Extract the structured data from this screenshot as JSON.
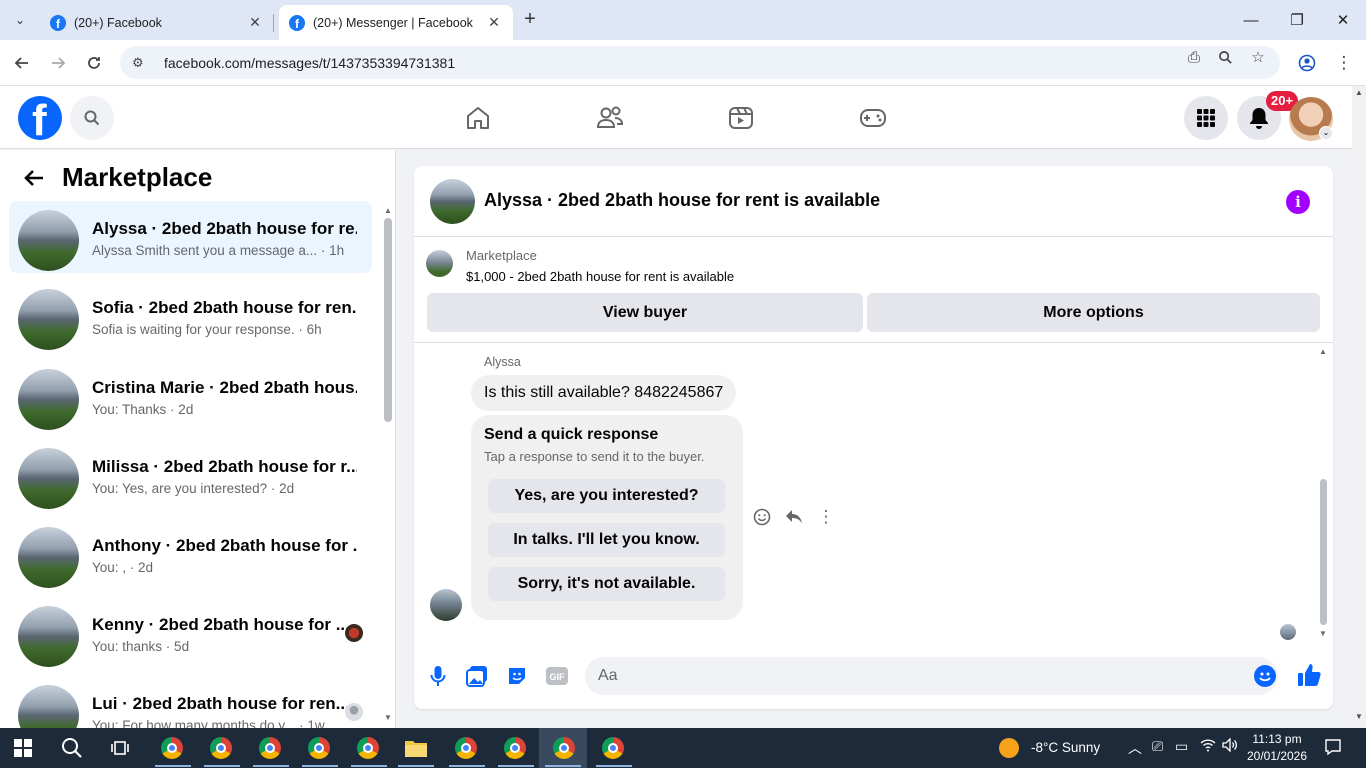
{
  "browser": {
    "tabs": [
      {
        "title": "(20+) Facebook",
        "active": false
      },
      {
        "title": "(20+) Messenger | Facebook",
        "active": true
      }
    ],
    "url": "facebook.com/messages/t/1437353394731381"
  },
  "header": {
    "notification_badge": "20+"
  },
  "left_pane": {
    "title": "Marketplace",
    "conversations": [
      {
        "name": "Alyssa · 2bed 2bath house for re...",
        "preview": "Alyssa Smith sent you a message a... · 1h",
        "selected": true
      },
      {
        "name": "Sofia · 2bed 2bath house for ren...",
        "preview": "Sofia is waiting for your response. · 6h",
        "selected": false
      },
      {
        "name": "Cristina Marie · 2bed 2bath hous...",
        "preview": "You: Thanks · 2d",
        "selected": false
      },
      {
        "name": "Milissa · 2bed 2bath house for r...",
        "preview": "You: Yes, are you interested? · 2d",
        "selected": false
      },
      {
        "name": "Anthony · 2bed 2bath house for ...",
        "preview": "You: , · 2d",
        "selected": false
      },
      {
        "name": "Kenny · 2bed 2bath house for ...",
        "preview": "You: thanks · 5d",
        "selected": false
      },
      {
        "name": "Lui · 2bed 2bath house for ren...",
        "preview": "You: For how many months do y... · 1w",
        "selected": false
      }
    ]
  },
  "chat": {
    "title": "Alyssa · 2bed 2bath house for rent is available",
    "marketplace_label": "Marketplace",
    "listing": "$1,000 - 2bed 2bath house for rent is available",
    "view_buyer": "View buyer",
    "more_options": "More options",
    "sender": "Alyssa",
    "message": "Is this still available?  8482245867",
    "quick_title": "Send a quick response",
    "quick_subtitle": "Tap a response to send it to the buyer.",
    "quick_options": [
      "Yes, are you interested?",
      "In talks. I'll let you know.",
      "Sorry, it's not available."
    ],
    "composer_placeholder": "Aa"
  },
  "taskbar": {
    "weather": "-8°C  Sunny",
    "time": "11:13 pm",
    "date": "20/01/2026"
  },
  "colors": {
    "fb_blue": "#0866ff",
    "selected_row": "#ebf5ff",
    "badge_red": "#e41e3f",
    "info_purple": "#a200ff"
  }
}
